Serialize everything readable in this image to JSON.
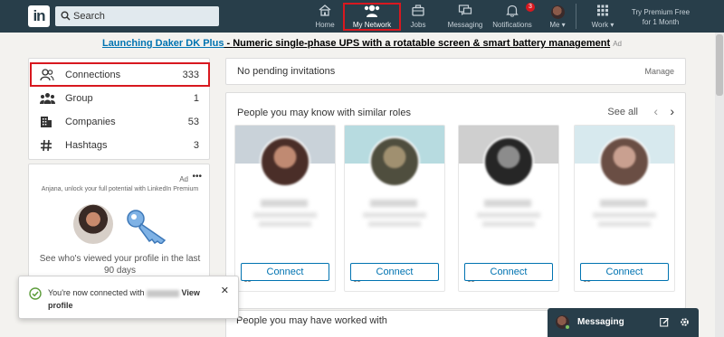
{
  "nav": {
    "logo": "in",
    "search_placeholder": "Search",
    "items": [
      {
        "label": "Home",
        "icon": "home-icon"
      },
      {
        "label": "My Network",
        "icon": "network-icon"
      },
      {
        "label": "Jobs",
        "icon": "briefcase-icon"
      },
      {
        "label": "Messaging",
        "icon": "messaging-icon"
      },
      {
        "label": "Notifications",
        "icon": "bell-icon"
      },
      {
        "label": "Me ▾",
        "icon": "avatar"
      },
      {
        "label": "Work ▾",
        "icon": "grid-icon"
      }
    ],
    "notifications_count": "3",
    "premium_line1": "Try Premium Free",
    "premium_line2": "for 1 Month",
    "active_color": "#ffffff",
    "bar_color": "#283e4a"
  },
  "ad": {
    "title": "Launching Daker DK Plus",
    "separator": " - ",
    "text": "Numeric single-phase UPS with a rotatable screen & smart battery management",
    "tag": "Ad"
  },
  "sidebar": {
    "items": [
      {
        "label": "Connections",
        "count": "333",
        "icon": "people-icon"
      },
      {
        "label": "Group",
        "count": "1",
        "icon": "group-icon"
      },
      {
        "label": "Companies",
        "count": "53",
        "icon": "building-icon"
      },
      {
        "label": "Hashtags",
        "count": "3",
        "icon": "hashtag-icon"
      }
    ],
    "ad_label": "Ad",
    "ad_menu": "•••",
    "ad_subtitle": "Anjana, unlock your full potential with LinkedIn Premium",
    "ad_view_text": "See who's viewed your profile in the last 90 days"
  },
  "main": {
    "pending_text": "No pending invitations",
    "manage_label": "Manage",
    "pymk_title": "People you may know with similar roles",
    "see_all": "See all",
    "prev": "‹",
    "next": "›",
    "people": [
      {
        "mutual": "24 mutual connections",
        "connect": "Connect",
        "banner": "#c9d2d9",
        "photo": "#7a5548"
      },
      {
        "mutual": "15 mutual connections",
        "connect": "Connect",
        "banner": "#b7dbe0",
        "photo": "#6b6a55"
      },
      {
        "mutual": "10 mutual connections",
        "connect": "Connect",
        "banner": "#cfcfcf",
        "photo": "#2e2e2e"
      },
      {
        "mutual": "7 mutual connections",
        "connect": "Connect",
        "banner": "#d7e9ee",
        "photo": "#8a6e62"
      }
    ],
    "worked_title": "People you may have worked with"
  },
  "toast": {
    "text_before": "You're now connected with ",
    "view_label": "View profile",
    "close": "✕"
  },
  "messaging": {
    "label": "Messaging"
  },
  "colors": {
    "accent": "#0073b1",
    "highlight_box": "#d8181f",
    "success": "#5c9c3a"
  }
}
